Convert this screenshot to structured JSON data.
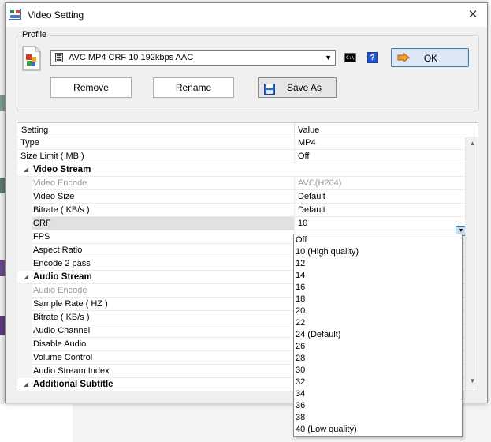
{
  "window": {
    "title": "Video Setting",
    "close_glyph": "✕"
  },
  "profile": {
    "group_label": "Profile",
    "selected_profile": "AVC MP4 CRF 10 192kbps AAC",
    "ok_label": "OK",
    "help_glyph": "?",
    "cmd_glyph": "C:\\",
    "remove_label": "Remove",
    "rename_label": "Rename",
    "save_as_label": "Save As"
  },
  "grid": {
    "header_setting": "Setting",
    "header_value": "Value",
    "rows": [
      {
        "name": "Type",
        "value": "MP4"
      },
      {
        "name": "Size Limit ( MB )",
        "value": "Off"
      },
      {
        "name": "Video Stream",
        "value": ""
      },
      {
        "name": "Video Encode",
        "value": "AVC(H264)"
      },
      {
        "name": "Video Size",
        "value": "Default"
      },
      {
        "name": "Bitrate ( KB/s )",
        "value": "Default"
      },
      {
        "name": "CRF",
        "value": "10"
      },
      {
        "name": "FPS",
        "value": ""
      },
      {
        "name": "Aspect Ratio",
        "value": ""
      },
      {
        "name": "Encode 2 pass",
        "value": ""
      },
      {
        "name": "Audio Stream",
        "value": ""
      },
      {
        "name": "Audio Encode",
        "value": ""
      },
      {
        "name": "Sample Rate ( HZ )",
        "value": ""
      },
      {
        "name": "Bitrate ( KB/s )",
        "value": ""
      },
      {
        "name": "Audio Channel",
        "value": ""
      },
      {
        "name": "Disable Audio",
        "value": ""
      },
      {
        "name": "Volume Control",
        "value": ""
      },
      {
        "name": "Audio Stream Index",
        "value": ""
      },
      {
        "name": "Additional Subtitle",
        "value": ""
      }
    ]
  },
  "crf_dropdown": {
    "options": [
      "Off",
      "10 (High quality)",
      "12",
      "14",
      "16",
      "18",
      "20",
      "22",
      "24 (Default)",
      "26",
      "28",
      "30",
      "32",
      "34",
      "36",
      "38",
      "40 (Low quality)"
    ]
  },
  "icons": {
    "title": "video-setting-icon",
    "profile": "profile-format-icon",
    "combo": "film-icon",
    "ok": "arrow-right-icon",
    "save": "floppy-disk-icon",
    "help": "help-icon",
    "cmd": "command-line-icon"
  },
  "colors": {
    "ok_border": "#3c7fb1",
    "selected_row": "#e1e1e1",
    "help_blue": "#2255cc"
  }
}
